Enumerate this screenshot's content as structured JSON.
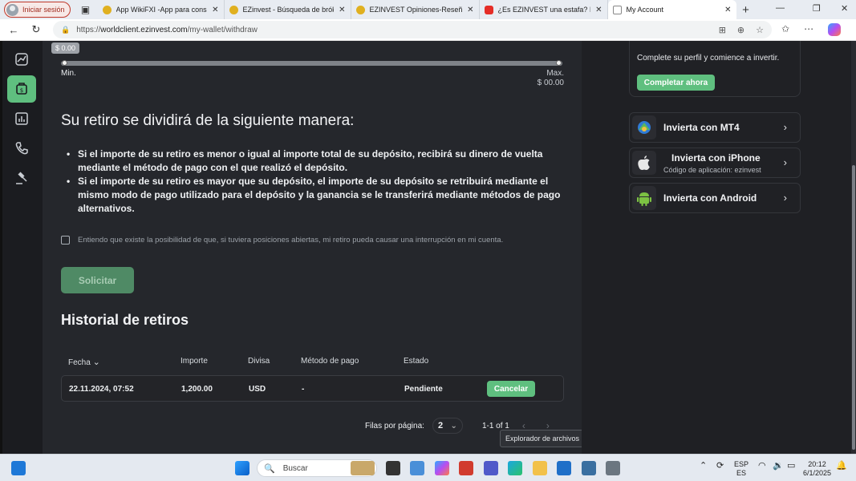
{
  "browser": {
    "signin_label": "Iniciar sesión",
    "tabs": [
      {
        "label": "App WikiFXI -App para consulta",
        "color": "#e0b020"
      },
      {
        "label": "EZinvest - Búsqueda de bróker c",
        "color": "#e0b020"
      },
      {
        "label": "EZINVEST Opiniones-Reseñas d",
        "color": "#e0b020"
      },
      {
        "label": "¿Es EZINVEST una estafa? Inverc",
        "color": "#e52d27"
      },
      {
        "label": "My Account",
        "color": "#ffffff",
        "active": true
      }
    ],
    "url_scheme": "https://",
    "url_host": "worldclient.ezinvest.com",
    "url_path": "/my-wallet/withdraw"
  },
  "slider": {
    "tooltip": "$ 0.00",
    "value_fraction": 0.0,
    "min_label": "Min.",
    "max_label": "Max.",
    "max_value": "$ 00.00"
  },
  "withdraw": {
    "heading": "Su retiro se dividirá de la siguiente manera:",
    "bullets": [
      "Si el importe de su retiro es menor o igual al importe total de su depósito, recibirá su dinero de vuelta mediante el método de pago con el que realizó el depósito.",
      "Si el importe de su retiro es mayor que su depósito, el importe de su depósito se retribuirá mediante el mismo modo de pago utilizado para el depósito y la ganancia se le transferirá mediante métodos de pago alternativos."
    ],
    "checkbox_label": "Entiendo que existe la posibilidad de que, si tuviera posiciones abiertas, mi retiro pueda causar una interrupción en mi cuenta.",
    "submit_label": "Solicitar"
  },
  "history": {
    "heading": "Historial de retiros",
    "columns": [
      "Fecha",
      "Importe",
      "Divisa",
      "Método de pago",
      "Estado"
    ],
    "rows": [
      {
        "fecha": "22.11.2024, 07:52",
        "importe": "1,200.00",
        "divisa": "USD",
        "metodo": "-",
        "estado": "Pendiente",
        "action": "Cancelar"
      }
    ],
    "rows_per_page_label": "Filas por página:",
    "rows_per_page": "2",
    "range": "1-1 of 1"
  },
  "tooltip_explorer": "Explorador de archivos",
  "sidebar": {
    "profile_text": "Complete su perfil y comience a invertir.",
    "profile_button": "Completar ahora",
    "apps": [
      {
        "title": "Invierta con MT4",
        "sub": ""
      },
      {
        "title": "Invierta con iPhone",
        "sub": "Código de aplicación: ezinvest"
      },
      {
        "title": "Invierta con Android",
        "sub": ""
      }
    ]
  },
  "taskbar": {
    "search_label": "Buscar",
    "lang_top": "ESP",
    "lang_bottom": "ES",
    "time": "20:12",
    "date": "6/1/2025"
  },
  "colors": {
    "accent": "#5fbf7f",
    "page_bg": "#25272c"
  }
}
